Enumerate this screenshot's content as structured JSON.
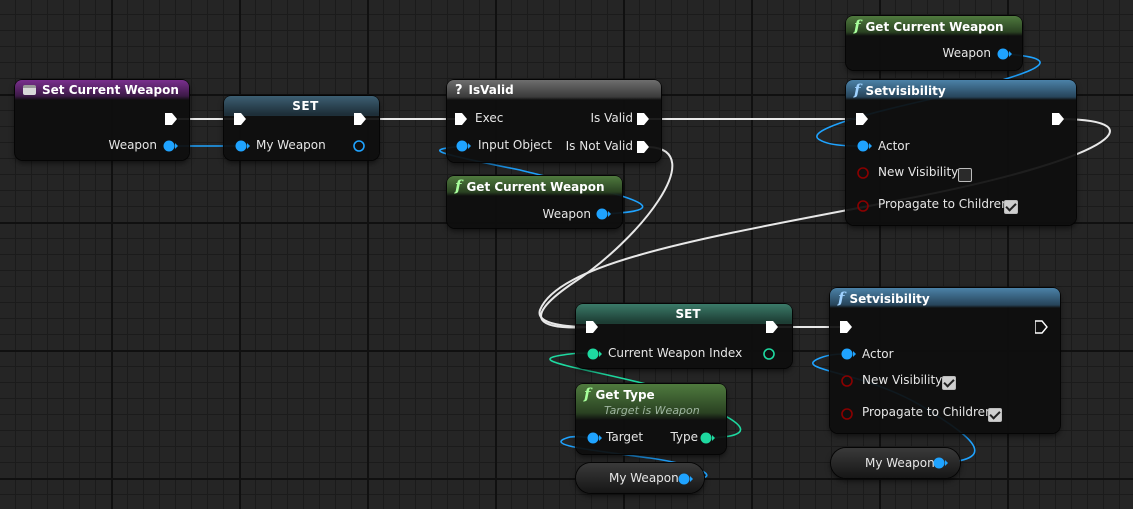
{
  "colors": {
    "exec": "#ffffff",
    "object": "#1fa3ff",
    "integer": "#1ed9a0",
    "boolean": "#8a0000",
    "event_header": "#7a2f8e",
    "pure_header": "#4f7a3e",
    "function_header": "#4b82a8",
    "set_header": "#3d5f73",
    "macro_header": "#6e6e6e"
  },
  "icons": {
    "event": "event-icon",
    "function": "function-icon",
    "macro": "question-icon"
  },
  "nodes": {
    "set_current_weapon": {
      "title": "Set Current Weapon",
      "pin_weapon": "Weapon"
    },
    "set_my_weapon": {
      "title": "SET",
      "pin_my_weapon": "My Weapon"
    },
    "is_valid": {
      "title": "IsValid",
      "pin_exec": "Exec",
      "pin_input_object": "Input Object",
      "pin_is_valid": "Is Valid",
      "pin_is_not_valid": "Is Not Valid"
    },
    "get_current_weapon_1": {
      "title": "Get Current Weapon",
      "pin_weapon": "Weapon"
    },
    "get_current_weapon_2": {
      "title": "Get Current Weapon",
      "pin_weapon": "Weapon"
    },
    "set_visibility_1": {
      "title": "Setvisibility",
      "pin_actor": "Actor",
      "pin_new_visibility": "New Visibility",
      "pin_propagate": "Propagate to Children",
      "new_visibility_checked": false,
      "propagate_checked": true
    },
    "set_index": {
      "title": "SET",
      "pin_index": "Current Weapon Index"
    },
    "get_type": {
      "title": "Get Type",
      "subtitle": "Target is Weapon",
      "pin_target": "Target",
      "pin_type": "Type"
    },
    "my_weapon_var_1": {
      "label": "My Weapon"
    },
    "set_visibility_2": {
      "title": "Setvisibility",
      "pin_actor": "Actor",
      "pin_new_visibility": "New Visibility",
      "pin_propagate": "Propagate to Children",
      "new_visibility_checked": true,
      "propagate_checked": true
    },
    "my_weapon_var_2": {
      "label": "My Weapon"
    }
  }
}
